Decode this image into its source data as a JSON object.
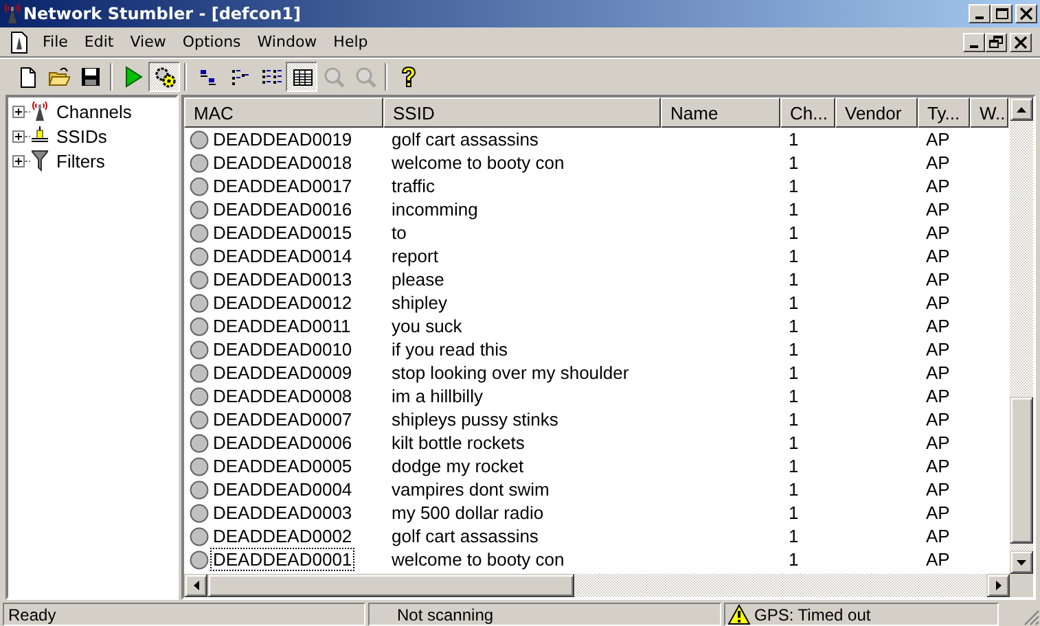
{
  "window": {
    "title": "Network Stumbler - [defcon1]"
  },
  "menu": [
    "File",
    "Edit",
    "View",
    "Options",
    "Window",
    "Help"
  ],
  "toolbar": [
    {
      "kind": "new",
      "pressed": false,
      "disabled": false
    },
    {
      "kind": "open",
      "pressed": false,
      "disabled": false
    },
    {
      "kind": "save",
      "pressed": false,
      "disabled": false
    },
    {
      "kind": "separator"
    },
    {
      "kind": "play",
      "pressed": false,
      "disabled": false
    },
    {
      "kind": "gear",
      "pressed": true,
      "disabled": false
    },
    {
      "kind": "separator"
    },
    {
      "kind": "icons",
      "pressed": false,
      "disabled": false
    },
    {
      "kind": "list",
      "pressed": false,
      "disabled": false
    },
    {
      "kind": "details",
      "pressed": false,
      "disabled": false
    },
    {
      "kind": "grid",
      "pressed": true,
      "disabled": false
    },
    {
      "kind": "zoomin",
      "pressed": false,
      "disabled": true
    },
    {
      "kind": "zoomout",
      "pressed": false,
      "disabled": true
    },
    {
      "kind": "separator"
    },
    {
      "kind": "help",
      "pressed": false,
      "disabled": false
    }
  ],
  "tree": [
    {
      "label": "Channels",
      "kind": "antenna",
      "expanded": false
    },
    {
      "label": "SSIDs",
      "kind": "ssid",
      "expanded": false
    },
    {
      "label": "Filters",
      "kind": "filter",
      "expanded": false
    }
  ],
  "table": {
    "columns": [
      "MAC",
      "SSID",
      "Name",
      "Ch...",
      "Vendor",
      "Ty...",
      "W..."
    ],
    "rows": [
      {
        "mac": "DEADDEAD0019",
        "ssid": "golf cart assassins",
        "channel": "1",
        "type": "AP",
        "focused": false
      },
      {
        "mac": "DEADDEAD0018",
        "ssid": "welcome to booty con",
        "channel": "1",
        "type": "AP",
        "focused": false
      },
      {
        "mac": "DEADDEAD0017",
        "ssid": "traffic",
        "channel": "1",
        "type": "AP",
        "focused": false
      },
      {
        "mac": "DEADDEAD0016",
        "ssid": "incomming",
        "channel": "1",
        "type": "AP",
        "focused": false
      },
      {
        "mac": "DEADDEAD0015",
        "ssid": "to",
        "channel": "1",
        "type": "AP",
        "focused": false
      },
      {
        "mac": "DEADDEAD0014",
        "ssid": "report",
        "channel": "1",
        "type": "AP",
        "focused": false
      },
      {
        "mac": "DEADDEAD0013",
        "ssid": "please",
        "channel": "1",
        "type": "AP",
        "focused": false
      },
      {
        "mac": "DEADDEAD0012",
        "ssid": "shipley",
        "channel": "1",
        "type": "AP",
        "focused": false
      },
      {
        "mac": "DEADDEAD0011",
        "ssid": "you suck",
        "channel": "1",
        "type": "AP",
        "focused": false
      },
      {
        "mac": "DEADDEAD0010",
        "ssid": "if you read this",
        "channel": "1",
        "type": "AP",
        "focused": false
      },
      {
        "mac": "DEADDEAD0009",
        "ssid": "stop looking over my shoulder",
        "channel": "1",
        "type": "AP",
        "focused": false
      },
      {
        "mac": "DEADDEAD0008",
        "ssid": "im a hillbilly",
        "channel": "1",
        "type": "AP",
        "focused": false
      },
      {
        "mac": "DEADDEAD0007",
        "ssid": "shipleys pussy stinks",
        "channel": "1",
        "type": "AP",
        "focused": false
      },
      {
        "mac": "DEADDEAD0006",
        "ssid": "kilt bottle rockets",
        "channel": "1",
        "type": "AP",
        "focused": false
      },
      {
        "mac": "DEADDEAD0005",
        "ssid": "dodge my rocket",
        "channel": "1",
        "type": "AP",
        "focused": false
      },
      {
        "mac": "DEADDEAD0004",
        "ssid": "vampires dont swim",
        "channel": "1",
        "type": "AP",
        "focused": false
      },
      {
        "mac": "DEADDEAD0003",
        "ssid": "my 500 dollar radio",
        "channel": "1",
        "type": "AP",
        "focused": false
      },
      {
        "mac": "DEADDEAD0002",
        "ssid": "golf cart assassins",
        "channel": "1",
        "type": "AP",
        "focused": false
      },
      {
        "mac": "DEADDEAD0001",
        "ssid": "welcome to booty con",
        "channel": "1",
        "type": "AP",
        "focused": true
      }
    ]
  },
  "status_bar": {
    "message": "Ready",
    "scan": "Not scanning",
    "gps": "GPS: Timed out"
  }
}
